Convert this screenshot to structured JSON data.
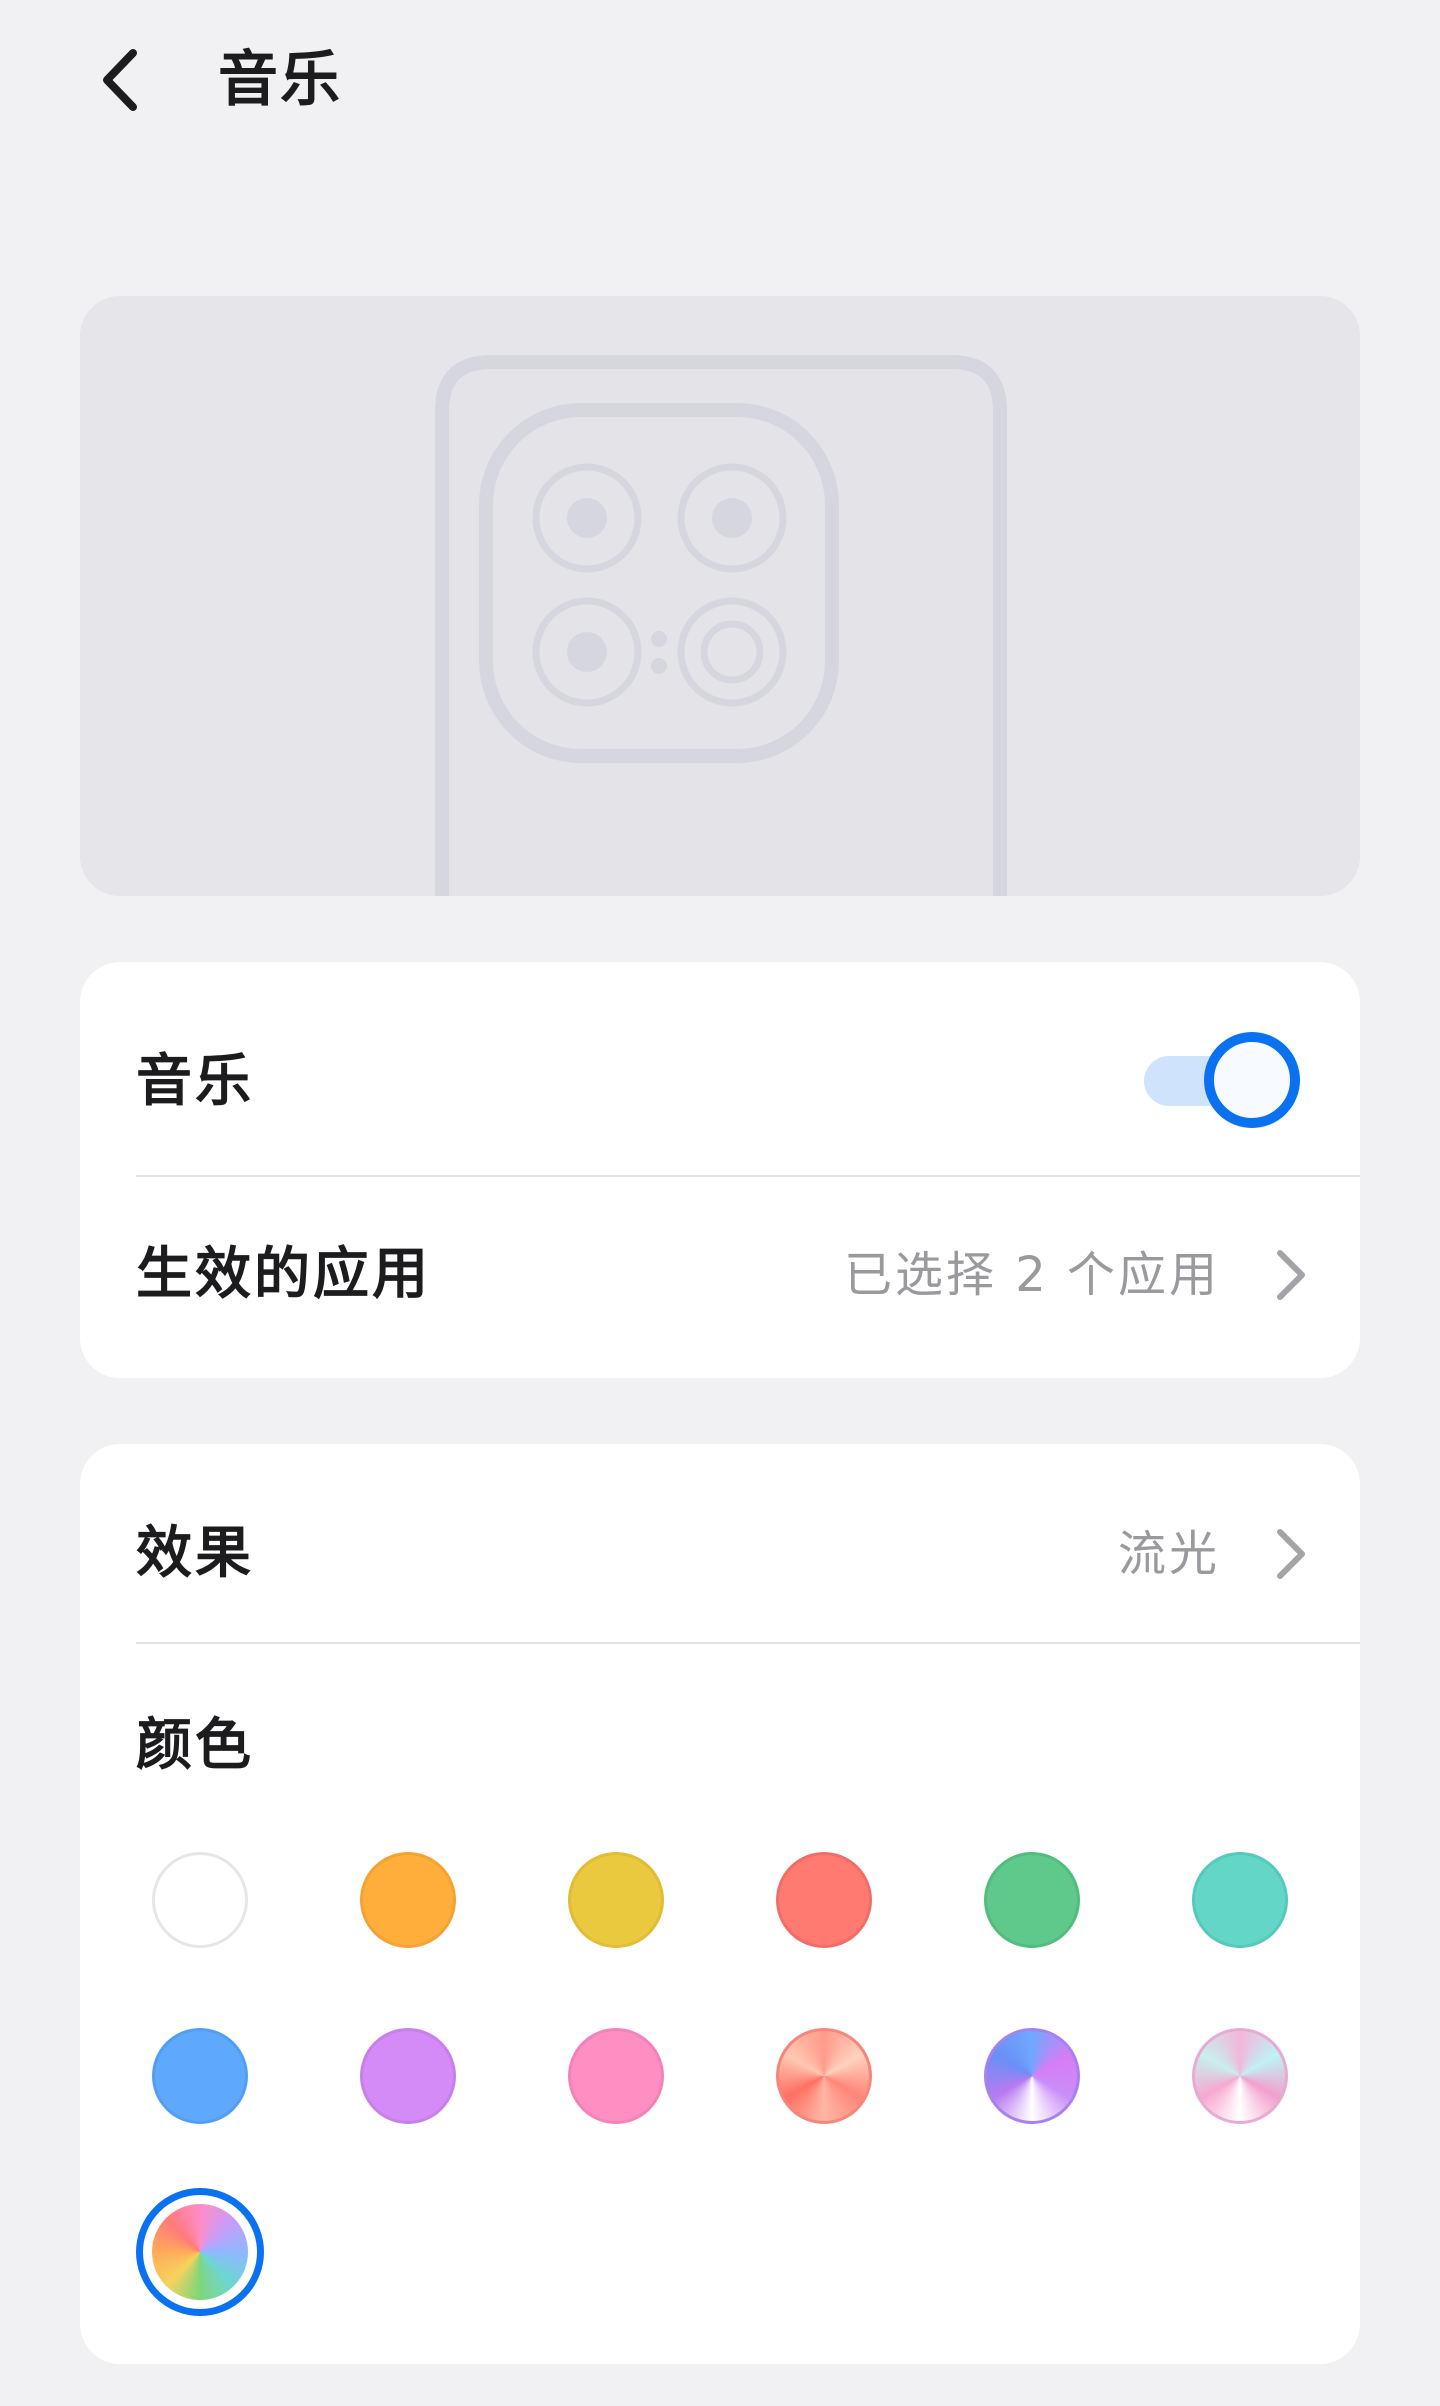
{
  "header": {
    "title": "音乐",
    "back_icon": "chevron-left-icon"
  },
  "preview": {
    "image": "phone-back-camera-illustration"
  },
  "music_section": {
    "music_label": "音乐",
    "music_enabled": true,
    "apps_label": "生效的应用",
    "apps_value": "已选择 2 个应用"
  },
  "effect_section": {
    "effect_label": "效果",
    "effect_value": "流光",
    "color_label": "颜色"
  },
  "colors": {
    "accent": "#0a72f0",
    "swatches": [
      {
        "name": "white",
        "color": "#ffffff"
      },
      {
        "name": "orange",
        "color": "#ffad3b"
      },
      {
        "name": "yellow",
        "color": "#ebc93f"
      },
      {
        "name": "coral",
        "color": "#ff7b72"
      },
      {
        "name": "green",
        "color": "#5ec98a"
      },
      {
        "name": "teal",
        "color": "#63d6c8"
      },
      {
        "name": "blue",
        "color": "#5ea9fd"
      },
      {
        "name": "purple",
        "color": "#d58bf7"
      },
      {
        "name": "pink",
        "color": "#ff8fc3"
      },
      {
        "name": "salmon-gradient",
        "color": "#ff8e7e"
      },
      {
        "name": "blue-purple-gradient",
        "color": "#a77ff5"
      },
      {
        "name": "cyan-pink-gradient",
        "color": "#e9b5d9"
      },
      {
        "name": "rainbow-gradient",
        "color": "#f59cc2"
      }
    ],
    "selected": "rainbow-gradient"
  }
}
